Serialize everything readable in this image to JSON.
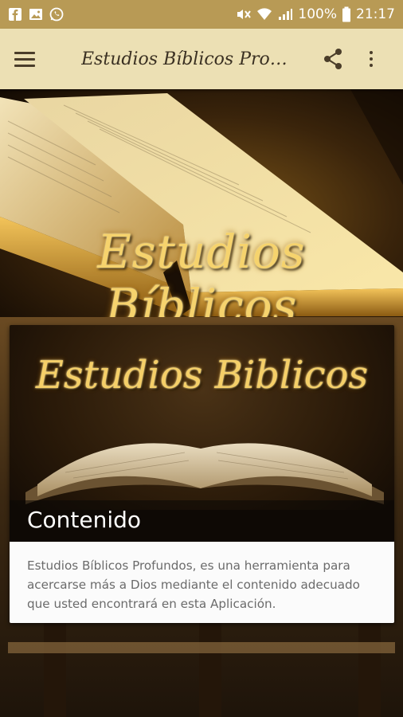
{
  "status_bar": {
    "left_icons": [
      "facebook-icon",
      "gallery-icon",
      "whatsapp-icon"
    ],
    "battery": "100%",
    "time": "21:17"
  },
  "app_bar": {
    "title": "Estudios Bíblicos Pro…"
  },
  "hero": {
    "title": "Estudios Bíblicos"
  },
  "card": {
    "image_title": "Estudios Biblicos",
    "caption": "Contenido",
    "description": "Estudios Bíblicos Profundos, es una herramienta para acercarse más a Dios mediante el contenido adecuado que usted encontrará en esta Aplicación."
  },
  "colors": {
    "status_bar": "#b89a55",
    "app_bar": "#ece0b4",
    "gold_text": "#f6d36d"
  }
}
